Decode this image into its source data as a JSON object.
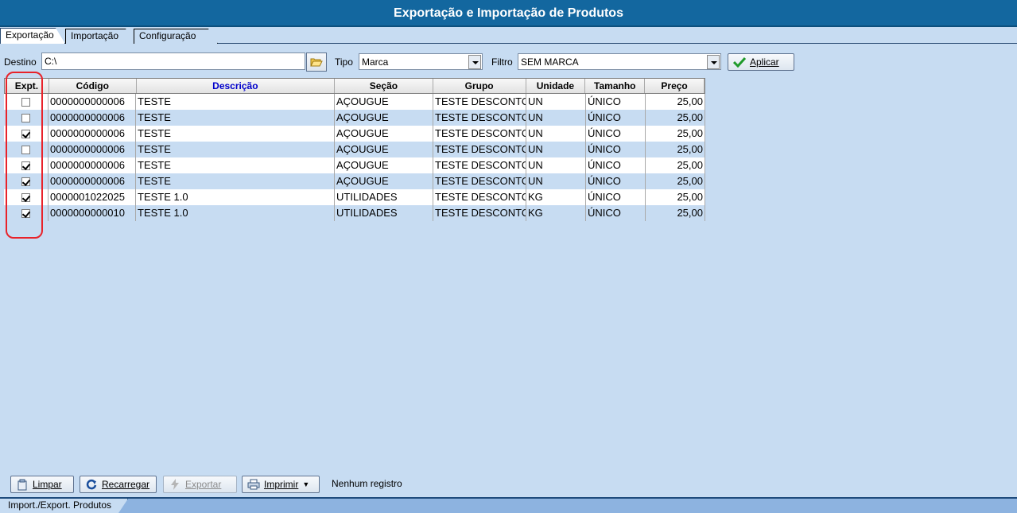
{
  "window": {
    "title": "Exportação e Importação de Produtos"
  },
  "tabs": [
    {
      "label": "Exportação",
      "active": true
    },
    {
      "label": "Importação",
      "active": false
    },
    {
      "label": "Configuração",
      "active": false
    }
  ],
  "filters": {
    "destino_label": "Destino",
    "destino_value": "C:\\",
    "tipo_label": "Tipo",
    "tipo_value": "Marca",
    "filtro_label": "Filtro",
    "filtro_value": "SEM MARCA",
    "aplicar_label": "Aplicar"
  },
  "grid": {
    "columns": [
      "Expt.",
      "Código",
      "Descrição",
      "Seção",
      "Grupo",
      "Unidade",
      "Tamanho",
      "Preço"
    ],
    "rows": [
      {
        "checked": false,
        "codigo": "0000000000006",
        "descricao": "TESTE",
        "secao": "AÇOUGUE",
        "grupo": "TESTE DESCONTO",
        "unidade": "UN",
        "tamanho": "ÚNICO",
        "preco": "25,00"
      },
      {
        "checked": false,
        "codigo": "0000000000006",
        "descricao": "TESTE",
        "secao": "AÇOUGUE",
        "grupo": "TESTE DESCONTO",
        "unidade": "UN",
        "tamanho": "ÚNICO",
        "preco": "25,00"
      },
      {
        "checked": true,
        "codigo": "0000000000006",
        "descricao": "TESTE",
        "secao": "AÇOUGUE",
        "grupo": "TESTE DESCONTO",
        "unidade": "UN",
        "tamanho": "ÚNICO",
        "preco": "25,00"
      },
      {
        "checked": false,
        "codigo": "0000000000006",
        "descricao": "TESTE",
        "secao": "AÇOUGUE",
        "grupo": "TESTE DESCONTO",
        "unidade": "UN",
        "tamanho": "ÚNICO",
        "preco": "25,00"
      },
      {
        "checked": true,
        "codigo": "0000000000006",
        "descricao": "TESTE",
        "secao": "AÇOUGUE",
        "grupo": "TESTE DESCONTO",
        "unidade": "UN",
        "tamanho": "ÚNICO",
        "preco": "25,00"
      },
      {
        "checked": true,
        "codigo": "0000000000006",
        "descricao": "TESTE",
        "secao": "AÇOUGUE",
        "grupo": "TESTE DESCONTO",
        "unidade": "UN",
        "tamanho": "ÚNICO",
        "preco": "25,00"
      },
      {
        "checked": true,
        "codigo": "0000001022025",
        "descricao": "TESTE 1.0",
        "secao": "UTILIDADES",
        "grupo": "TESTE DESCONTO",
        "unidade": "KG",
        "tamanho": "ÚNICO",
        "preco": "25,00"
      },
      {
        "checked": true,
        "codigo": "0000000000010",
        "descricao": "TESTE 1.0",
        "secao": "UTILIDADES",
        "grupo": "TESTE DESCONTO",
        "unidade": "KG",
        "tamanho": "ÚNICO",
        "preco": "25,00"
      }
    ]
  },
  "buttons": {
    "limpar": "Limpar",
    "recarregar": "Recarregar",
    "exportar": "Exportar",
    "imprimir": "Imprimir"
  },
  "status": {
    "message": "Nenhum registro",
    "tab_label": "Import./Export. Produtos"
  },
  "colors": {
    "title_bar": "#13679f",
    "background": "#c7dcf2",
    "highlight": "#e8222a",
    "header_text_highlight": "#0000cc"
  }
}
